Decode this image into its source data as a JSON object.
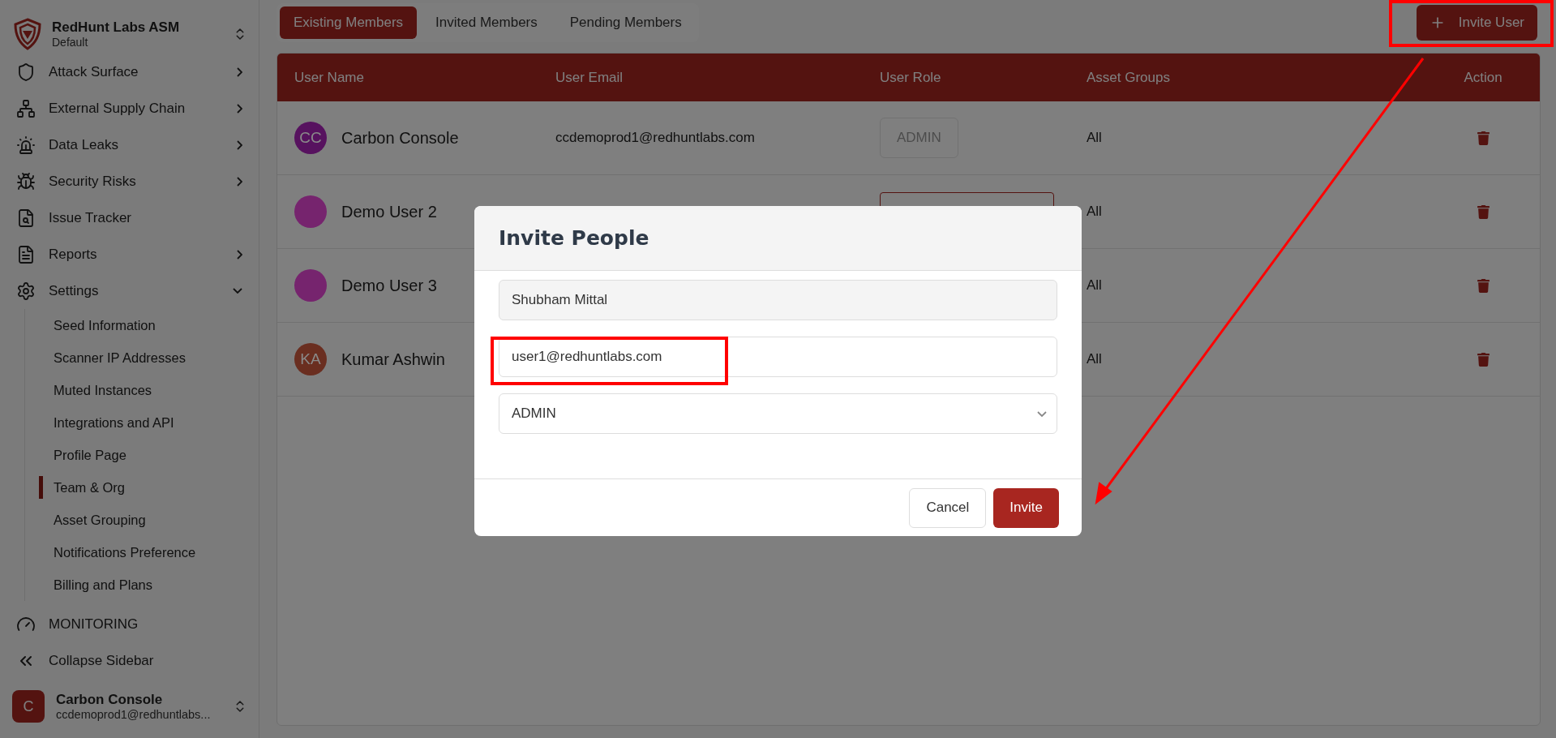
{
  "sidebar": {
    "org": {
      "title": "RedHunt Labs ASM",
      "subtitle": "Default"
    },
    "nav": [
      {
        "label": "Attack Surface",
        "kind": "group",
        "expanded": false
      },
      {
        "label": "External Supply Chain",
        "kind": "group",
        "expanded": false
      },
      {
        "label": "Data Leaks",
        "kind": "group",
        "expanded": false
      },
      {
        "label": "Security Risks",
        "kind": "group",
        "expanded": false
      },
      {
        "label": "Issue Tracker",
        "kind": "link"
      },
      {
        "label": "Reports",
        "kind": "group",
        "expanded": false
      },
      {
        "label": "Settings",
        "kind": "group",
        "expanded": true,
        "children": [
          {
            "label": "Seed Information",
            "selected": false
          },
          {
            "label": "Scanner IP Addresses",
            "selected": false
          },
          {
            "label": "Muted Instances",
            "selected": false
          },
          {
            "label": "Integrations and API",
            "selected": false
          },
          {
            "label": "Profile Page",
            "selected": false
          },
          {
            "label": "Team & Org",
            "selected": true
          },
          {
            "label": "Asset Grouping",
            "selected": false
          },
          {
            "label": "Notifications Preference",
            "selected": false
          },
          {
            "label": "Billing and Plans",
            "selected": false
          }
        ]
      }
    ],
    "monitoring": "MONITORING",
    "collapse": "Collapse Sidebar",
    "user": {
      "initial": "C",
      "name": "Carbon Console",
      "email": "ccdemoprod1@redhuntlabs..."
    }
  },
  "tabs": [
    {
      "label": "Existing Members",
      "selected": true
    },
    {
      "label": "Invited Members",
      "selected": false
    },
    {
      "label": "Pending Members",
      "selected": false
    }
  ],
  "invite_button": "Invite User",
  "table": {
    "columns": [
      "User Name",
      "User Email",
      "User Role",
      "Asset Groups",
      "Action"
    ],
    "rows": [
      {
        "initials": "CC",
        "color": "#57125f",
        "name": "Carbon Console",
        "email": "ccdemoprod1@redhuntlabs.com",
        "kind": "badge",
        "role": "ADMIN",
        "asset_groups": "All"
      },
      {
        "color": "#76246e",
        "name": "Demo User 2",
        "kind": "select",
        "asset_groups": "All"
      },
      {
        "color": "#76246e",
        "name": "Demo User 3",
        "kind": "plain",
        "asset_groups": "All"
      },
      {
        "initials": "KA",
        "color": "#6a2e20",
        "name": "Kumar Ashwin",
        "kind": "plain",
        "asset_groups": "All"
      }
    ]
  },
  "modal": {
    "title": "Invite People",
    "name_value": "Shubham Mittal",
    "email_value": "user1@redhuntlabs.com",
    "role_value": "ADMIN",
    "cancel": "Cancel",
    "submit": "Invite"
  }
}
